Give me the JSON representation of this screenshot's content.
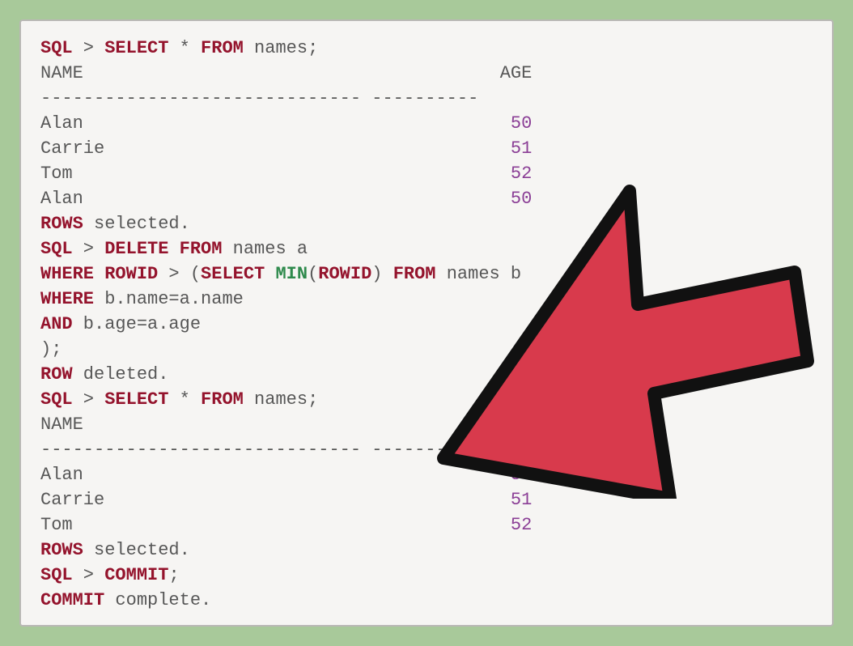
{
  "lines": [
    {
      "segments": [
        {
          "t": "SQL",
          "c": "kw"
        },
        {
          "t": " > ",
          "c": "pkw"
        },
        {
          "t": "SELECT",
          "c": "kw"
        },
        {
          "t": " * ",
          "c": "pkw"
        },
        {
          "t": "FROM",
          "c": "kw"
        },
        {
          "t": " names;",
          "c": "pkw"
        }
      ]
    },
    {
      "segments": [
        {
          "t": "NAME                                       AGE",
          "c": "pkw"
        }
      ]
    },
    {
      "segments": [
        {
          "t": "------------------------------ ----------",
          "c": "pkw"
        }
      ]
    },
    {
      "segments": [
        {
          "t": "Alan                                        ",
          "c": "pkw"
        },
        {
          "t": "50",
          "c": "num"
        }
      ]
    },
    {
      "segments": [
        {
          "t": "Carrie                                      ",
          "c": "pkw"
        },
        {
          "t": "51",
          "c": "num"
        }
      ]
    },
    {
      "segments": [
        {
          "t": "Tom                                         ",
          "c": "pkw"
        },
        {
          "t": "52",
          "c": "num"
        }
      ]
    },
    {
      "segments": [
        {
          "t": "Alan                                        ",
          "c": "pkw"
        },
        {
          "t": "50",
          "c": "num"
        }
      ]
    },
    {
      "segments": [
        {
          "t": "ROWS",
          "c": "kw"
        },
        {
          "t": " selected.",
          "c": "pkw"
        }
      ]
    },
    {
      "segments": [
        {
          "t": "SQL",
          "c": "kw"
        },
        {
          "t": " > ",
          "c": "pkw"
        },
        {
          "t": "DELETE FROM",
          "c": "kw"
        },
        {
          "t": " names a",
          "c": "pkw"
        }
      ]
    },
    {
      "segments": [
        {
          "t": "WHERE ROWID",
          "c": "kw"
        },
        {
          "t": " > (",
          "c": "pkw"
        },
        {
          "t": "SELECT ",
          "c": "kw"
        },
        {
          "t": "MIN",
          "c": "fn"
        },
        {
          "t": "(",
          "c": "pkw"
        },
        {
          "t": "ROWID",
          "c": "kw"
        },
        {
          "t": ") ",
          "c": "pkw"
        },
        {
          "t": "FROM",
          "c": "kw"
        },
        {
          "t": " names b",
          "c": "pkw"
        }
      ]
    },
    {
      "segments": [
        {
          "t": "WHERE",
          "c": "kw"
        },
        {
          "t": " b.name=a.name",
          "c": "pkw"
        }
      ]
    },
    {
      "segments": [
        {
          "t": "AND",
          "c": "kw"
        },
        {
          "t": " b.age=a.age",
          "c": "pkw"
        }
      ]
    },
    {
      "segments": [
        {
          "t": ");",
          "c": "pkw"
        }
      ]
    },
    {
      "segments": [
        {
          "t": "ROW",
          "c": "kw"
        },
        {
          "t": " deleted.",
          "c": "pkw"
        }
      ]
    },
    {
      "segments": [
        {
          "t": "SQL",
          "c": "kw"
        },
        {
          "t": " > ",
          "c": "pkw"
        },
        {
          "t": "SELECT",
          "c": "kw"
        },
        {
          "t": " * ",
          "c": "pkw"
        },
        {
          "t": "FROM",
          "c": "kw"
        },
        {
          "t": " names;",
          "c": "pkw"
        }
      ]
    },
    {
      "segments": [
        {
          "t": "NAME                                       AGE",
          "c": "pkw"
        }
      ]
    },
    {
      "segments": [
        {
          "t": "------------------------------ ----------",
          "c": "pkw"
        }
      ]
    },
    {
      "segments": [
        {
          "t": "Alan                                        ",
          "c": "pkw"
        },
        {
          "t": "50",
          "c": "num"
        }
      ]
    },
    {
      "segments": [
        {
          "t": "Carrie                                      ",
          "c": "pkw"
        },
        {
          "t": "51",
          "c": "num"
        }
      ]
    },
    {
      "segments": [
        {
          "t": "Tom                                         ",
          "c": "pkw"
        },
        {
          "t": "52",
          "c": "num"
        }
      ]
    },
    {
      "segments": [
        {
          "t": "ROWS",
          "c": "kw"
        },
        {
          "t": " selected.",
          "c": "pkw"
        }
      ]
    },
    {
      "segments": [
        {
          "t": "SQL",
          "c": "kw"
        },
        {
          "t": " > ",
          "c": "pkw"
        },
        {
          "t": "COMMIT",
          "c": "kw"
        },
        {
          "t": ";",
          "c": "pkw"
        }
      ]
    },
    {
      "segments": [
        {
          "t": "COMMIT",
          "c": "kw"
        },
        {
          "t": " complete.",
          "c": "pkw"
        }
      ]
    }
  ]
}
